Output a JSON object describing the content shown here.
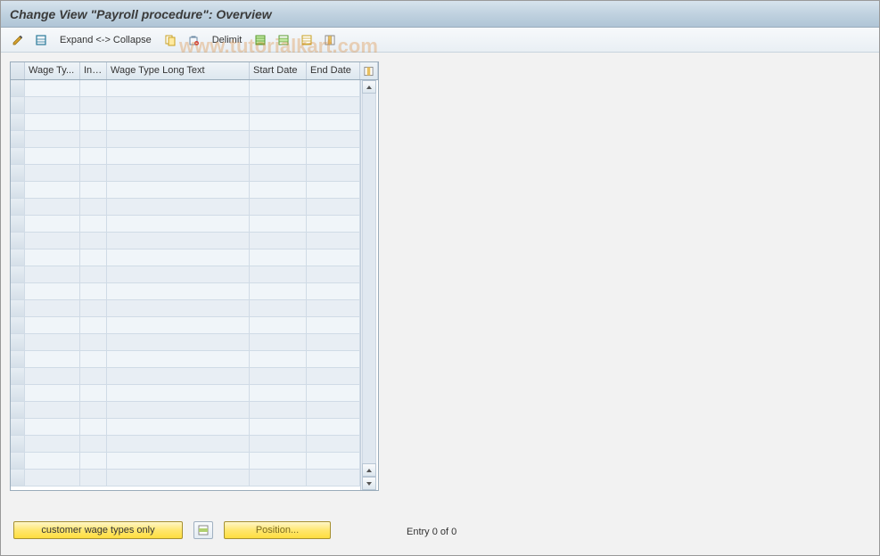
{
  "title": "Change View \"Payroll procedure\": Overview",
  "toolbar": {
    "expand_collapse_label": "Expand <-> Collapse",
    "delimit_label": "Delimit"
  },
  "table": {
    "columns": {
      "wage_type": "Wage Ty...",
      "inf": "Inf...",
      "wage_long": "Wage Type Long Text",
      "start_date": "Start Date",
      "end_date": "End Date"
    },
    "rows": [
      {},
      {},
      {},
      {},
      {},
      {},
      {},
      {},
      {},
      {},
      {},
      {},
      {},
      {},
      {},
      {},
      {},
      {},
      {},
      {},
      {},
      {},
      {},
      {}
    ]
  },
  "footer": {
    "customer_btn": "customer wage types only",
    "position_btn": "Position...",
    "entry_text": "Entry 0 of 0"
  },
  "watermark": "www.tutorialkart.com"
}
